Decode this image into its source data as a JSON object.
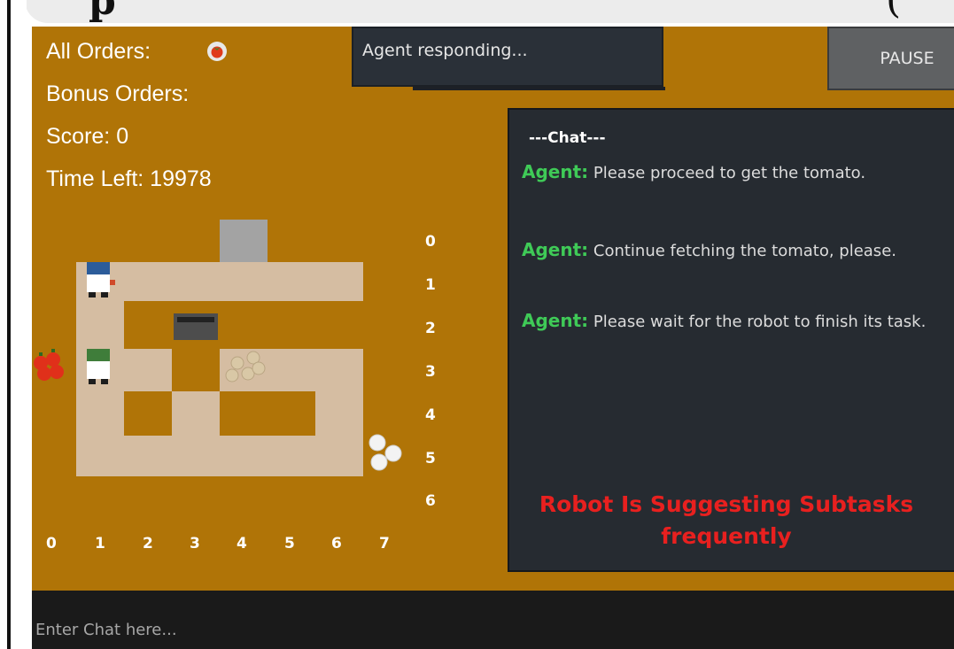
{
  "hud": {
    "all_orders_label": "All Orders:",
    "bonus_orders_label": "Bonus Orders:",
    "score_label": "Score: 0",
    "time_left_label": "Time Left: 19978"
  },
  "status": {
    "text": "Agent responding..."
  },
  "pause": {
    "label": "PAUSE"
  },
  "chat": {
    "title": "---Chat---",
    "messages": [
      {
        "sender": "Agent:",
        "text": " Please proceed to get the tomato."
      },
      {
        "sender": "Agent:",
        "text": " Continue fetching the tomato, please."
      },
      {
        "sender": "Agent:",
        "text": " Please wait for the robot to finish its task."
      }
    ],
    "warning": "Robot Is Suggesting Subtasks frequently"
  },
  "input": {
    "placeholder": "Enter Chat here..."
  },
  "grid": {
    "row_labels": [
      "0",
      "1",
      "2",
      "3",
      "4",
      "5",
      "6"
    ],
    "col_labels": [
      "0",
      "1",
      "2",
      "3",
      "4",
      "5",
      "6",
      "7"
    ]
  },
  "colors": {
    "background": "#b07407",
    "floor": "#d5bda2",
    "panel": "#262b31",
    "agent_name": "#3fca57",
    "warning": "#e8201f"
  },
  "icons": [
    "tomato-order-icon",
    "chef-blue-hat",
    "chef-green-hat",
    "onion-pile",
    "plates",
    "tomato-crate",
    "cooking-pot",
    "serving-counter"
  ]
}
